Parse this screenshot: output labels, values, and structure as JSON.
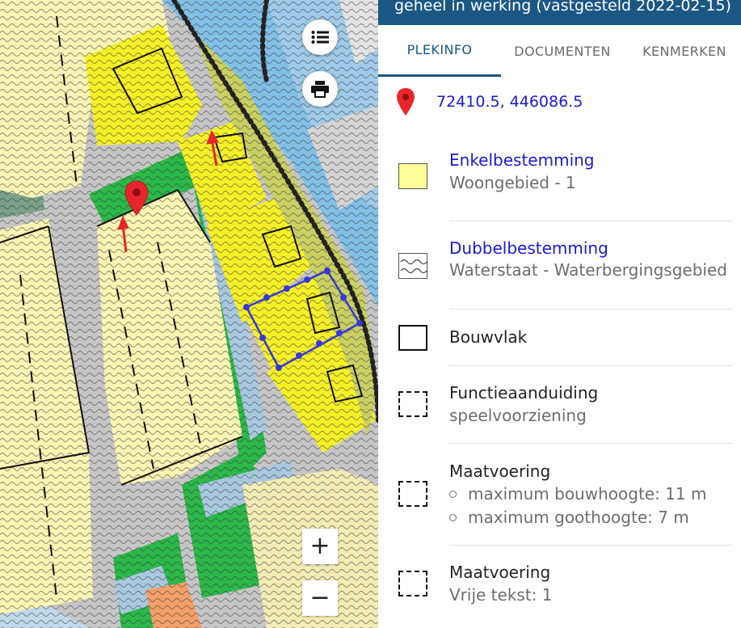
{
  "panel": {
    "header_title": "geheel in werking (vastgesteld 2022-02-15)",
    "tabs": [
      {
        "label": "PLEKINFO",
        "active": true
      },
      {
        "label": "DOCUMENTEN",
        "active": false
      },
      {
        "label": "KENMERKEN",
        "active": false
      }
    ],
    "coordinates": "72410.5, 446086.5"
  },
  "legend": [
    {
      "title": "Enkelbestemming",
      "subtitle": "Woongebied - 1",
      "swatch": "yellow-fill"
    },
    {
      "title": "Dubbelbestemming",
      "subtitle": "Waterstaat - Waterbergingsgebied",
      "swatch": "wavy-pattern"
    },
    {
      "title": "Bouwvlak",
      "swatch": "solid-outline"
    },
    {
      "title": "Functieaanduiding",
      "subtitle": "speelvoorziening",
      "swatch": "dashed-outline"
    },
    {
      "title": "Maatvoering",
      "bullets": [
        "maximum bouwhoogte: 11 m",
        "maximum goothoogte: 7 m"
      ],
      "swatch": "dashed-outline"
    },
    {
      "title": "Maatvoering",
      "subtitle": "Vrije tekst: 1",
      "swatch": "dashed-outline"
    }
  ],
  "map": {
    "zoom_in_label": "+",
    "zoom_out_label": "−",
    "buttons": [
      "list-icon",
      "print-icon"
    ],
    "marker_icon": "map-pin-icon"
  },
  "colors": {
    "header_bg": "#1b5784",
    "link": "#1a1ad4",
    "zone_yellow": "#ffff99",
    "zone_bright_yellow": "#f5ef28",
    "zone_green": "#2db84a",
    "water": "#82c0e6",
    "road": "#c6c6c6",
    "marker_red": "#e8262a"
  }
}
